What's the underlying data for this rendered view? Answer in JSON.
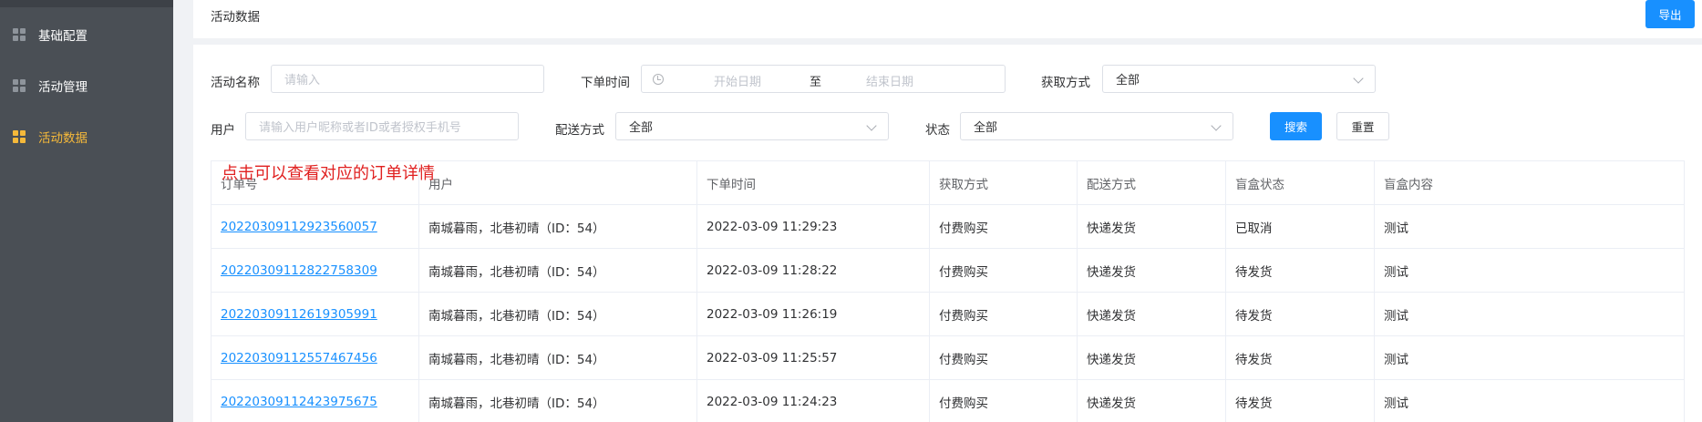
{
  "sidebar": {
    "items": [
      {
        "label": "基础配置",
        "icon": "grid-icon",
        "active": false
      },
      {
        "label": "活动管理",
        "icon": "grid-icon",
        "active": false
      },
      {
        "label": "活动数据",
        "icon": "grid-icon",
        "active": true
      }
    ]
  },
  "header": {
    "title": "活动数据",
    "export_label": "导出"
  },
  "filters": {
    "activity_name_label": "活动名称",
    "activity_name_placeholder": "请输入",
    "order_time_label": "下单时间",
    "start_date_placeholder": "开始日期",
    "date_separator": "至",
    "end_date_placeholder": "结束日期",
    "acquire_method_label": "获取方式",
    "acquire_method_value": "全部",
    "user_label": "用户",
    "user_placeholder": "请输入用户昵称或者ID或者授权手机号",
    "delivery_method_label": "配送方式",
    "delivery_method_value": "全部",
    "status_label": "状态",
    "status_value": "全部",
    "search_label": "搜索",
    "reset_label": "重置"
  },
  "annotation": "点击可以查看对应的订单详情",
  "table": {
    "columns": [
      "订单号",
      "用户",
      "下单时间",
      "获取方式",
      "配送方式",
      "盲盒状态",
      "盲盒内容"
    ],
    "rows": [
      {
        "order_no": "20220309112923560057",
        "user": "南城暮雨，北巷初晴（ID：54）",
        "time": "2022-03-09 11:29:23",
        "acquire": "付费购买",
        "delivery": "快递发货",
        "status": "已取消",
        "content": "测试"
      },
      {
        "order_no": "20220309112822758309",
        "user": "南城暮雨，北巷初晴（ID：54）",
        "time": "2022-03-09 11:28:22",
        "acquire": "付费购买",
        "delivery": "快递发货",
        "status": "待发货",
        "content": "测试"
      },
      {
        "order_no": "20220309112619305991",
        "user": "南城暮雨，北巷初晴（ID：54）",
        "time": "2022-03-09 11:26:19",
        "acquire": "付费购买",
        "delivery": "快递发货",
        "status": "待发货",
        "content": "测试"
      },
      {
        "order_no": "20220309112557467456",
        "user": "南城暮雨，北巷初晴（ID：54）",
        "time": "2022-03-09 11:25:57",
        "acquire": "付费购买",
        "delivery": "快递发货",
        "status": "待发货",
        "content": "测试"
      },
      {
        "order_no": "20220309112423975675",
        "user": "南城暮雨，北巷初晴（ID：54）",
        "time": "2022-03-09 11:24:23",
        "acquire": "付费购买",
        "delivery": "快递发货",
        "status": "待发货",
        "content": "测试"
      }
    ]
  },
  "colors": {
    "sidebar_bg": "#4a4f55",
    "active": "#f5b93a",
    "primary": "#1890ff",
    "annotation": "#e02020"
  }
}
